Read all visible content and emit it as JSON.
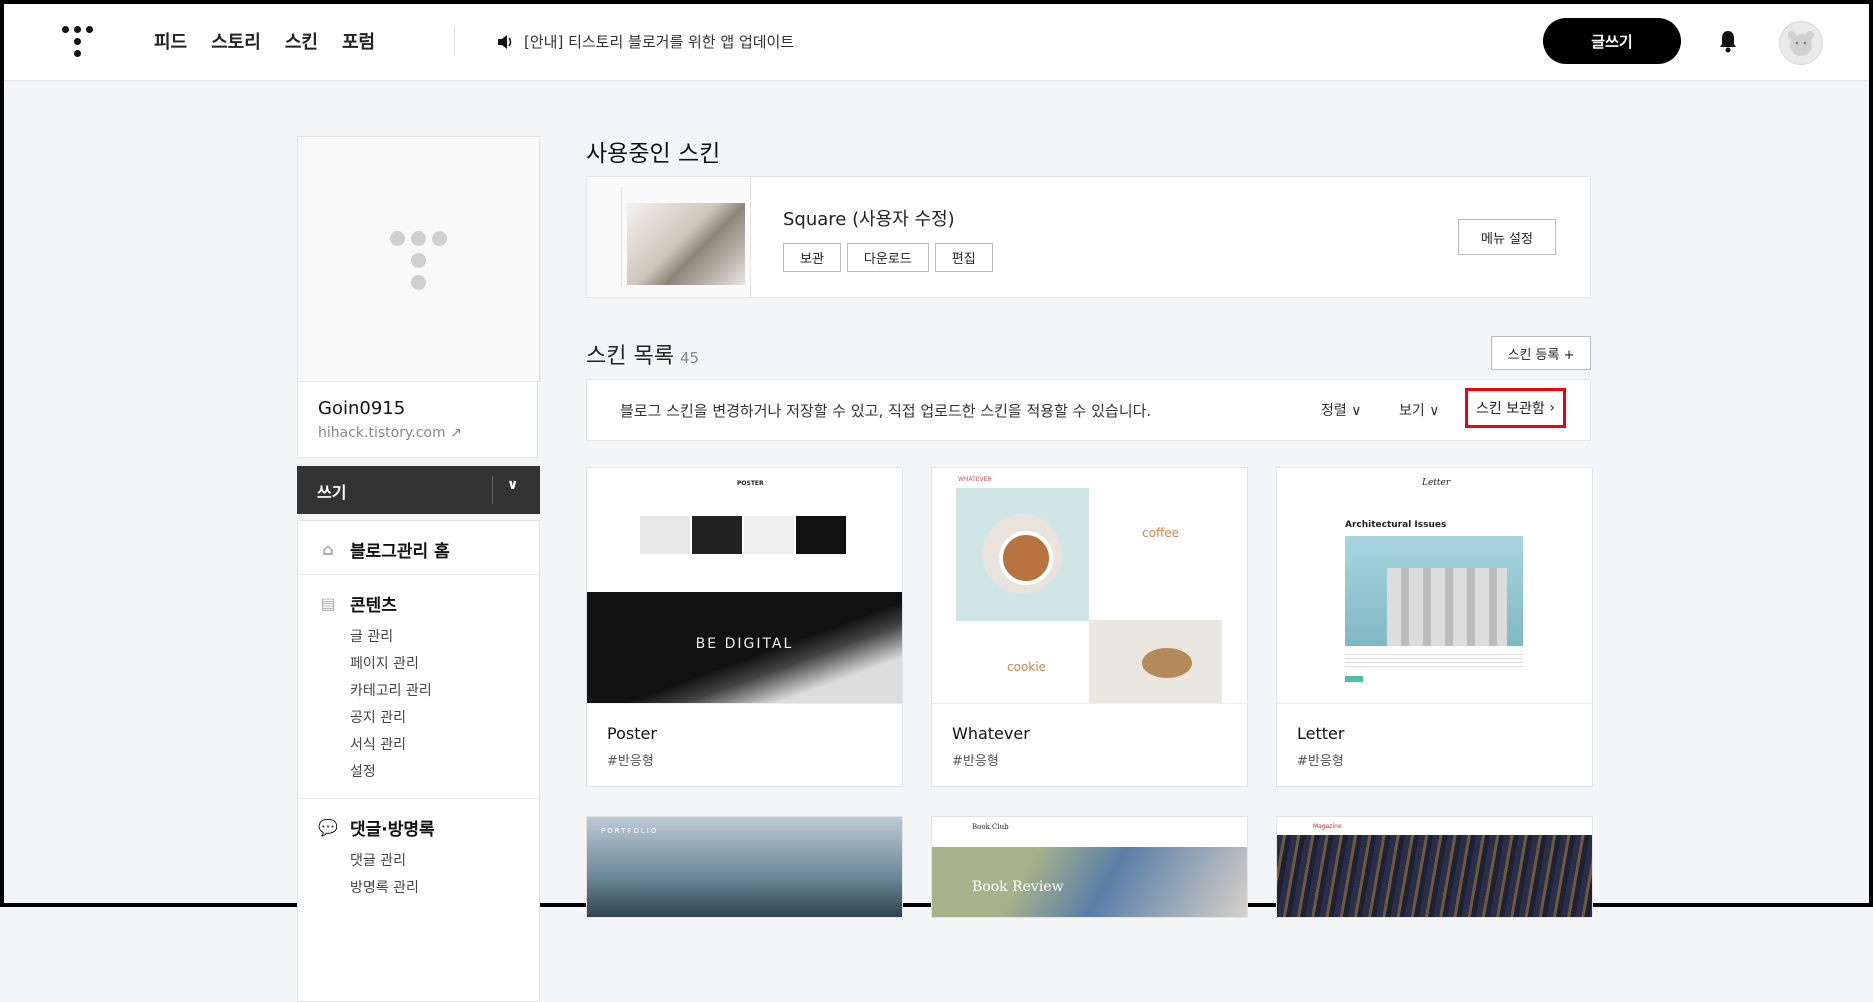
{
  "topbar": {
    "nav": [
      "피드",
      "스토리",
      "스킨",
      "포럼"
    ],
    "notice": "[안내] 티스토리 블로거를 위한 앱 업데이트",
    "write_label": "글쓰기"
  },
  "sidebar": {
    "blog_name": "Goin0915",
    "blog_url": "hihack.tistory.com",
    "write_label": "쓰기",
    "home_label": "블로그관리 홈",
    "contents": {
      "label": "콘텐츠",
      "items": [
        "글 관리",
        "페이지 관리",
        "카테고리 관리",
        "공지 관리",
        "서식 관리",
        "설정"
      ]
    },
    "comments": {
      "label": "댓글·방명록",
      "items": [
        "댓글 관리",
        "방명록 관리"
      ]
    }
  },
  "current_skin": {
    "title": "사용중인 스킨",
    "name": "Square (사용자 수정)",
    "buttons": [
      "보관",
      "다운로드",
      "편집"
    ],
    "menu_setting": "메뉴 설정"
  },
  "skin_list": {
    "title": "스킨 목록",
    "count": "45",
    "register_label": "스킨 등록 +",
    "description": "블로그 스킨을 변경하거나 저장할 수 있고, 직접 업로드한 스킨을 적용할 수 있습니다.",
    "sort_label": "정렬",
    "view_label": "보기",
    "storage_label": "스킨 보관함",
    "skins": [
      {
        "name": "Poster",
        "tag": "#반응형",
        "preview_text": "BE DIGITAL",
        "header": "POSTER"
      },
      {
        "name": "Whatever",
        "tag": "#반응형",
        "preview_text": "coffee",
        "preview_text2": "cookie",
        "header": "WHATEVER"
      },
      {
        "name": "Letter",
        "tag": "#반응형",
        "preview_text": "Architectural Issues",
        "header": "Letter"
      }
    ],
    "row2": [
      {
        "preview_text": "PORTFOLIO"
      },
      {
        "preview_text": "Book Review",
        "header": "Book Club"
      },
      {
        "header": "Magazine"
      }
    ]
  }
}
